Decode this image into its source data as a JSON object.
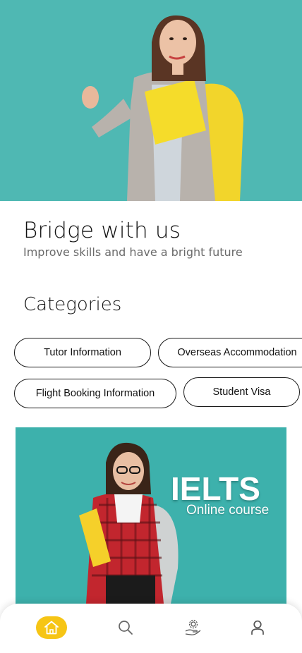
{
  "hero": {
    "image": "student-with-yellow-folder-thumbs-up"
  },
  "intro": {
    "title": "Bridge with us",
    "subtitle": "Improve skills and have a bright future"
  },
  "categories": {
    "heading": "Categories",
    "items": [
      {
        "label": "Tutor Information"
      },
      {
        "label": "Overseas Accommodation"
      },
      {
        "label": "Flight Booking Information"
      },
      {
        "label": "Student Visa"
      }
    ]
  },
  "banner": {
    "title": "IELTS",
    "subtitle": "Online course",
    "background": "#3db1ac"
  },
  "bottom_nav": {
    "items": [
      {
        "icon": "home-icon",
        "active": true
      },
      {
        "icon": "search-icon",
        "active": false
      },
      {
        "icon": "services-gear-hand-icon",
        "active": false
      },
      {
        "icon": "profile-icon",
        "active": false
      }
    ],
    "active_color": "#f6c515"
  },
  "colors": {
    "hero_bg": "#4fb8b3",
    "accent": "#f6c515"
  }
}
